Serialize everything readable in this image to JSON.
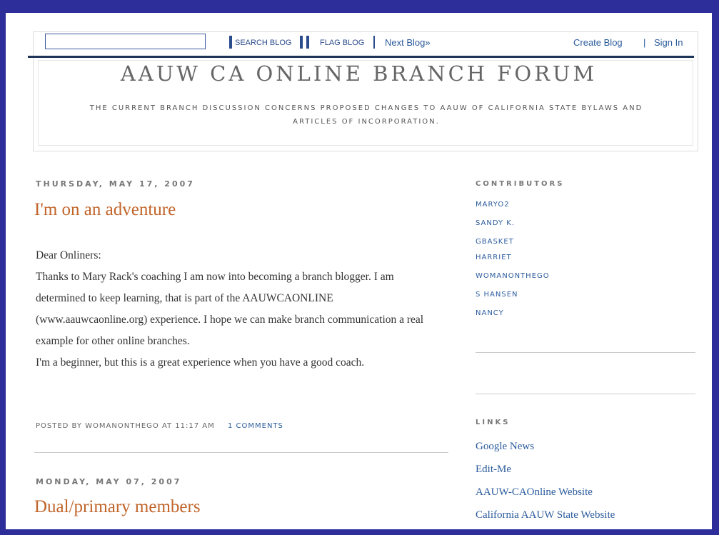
{
  "navbar": {
    "search_value": "",
    "search_button": "SEARCH BLOG",
    "flag_button": "FLAG BLOG",
    "next_blog": "Next Blog»",
    "create_blog": "Create Blog",
    "divider": "|",
    "sign_in": "Sign In"
  },
  "header": {
    "title": "AAUW CA ONLINE BRANCH FORUM",
    "description": "THE CURRENT BRANCH DISCUSSION CONCERNS PROPOSED CHANGES TO AAUW OF CALIFORNIA STATE BYLAWS AND ARTICLES OF INCORPORATION."
  },
  "posts": [
    {
      "date": "THURSDAY, MAY 17, 2007",
      "title": "I'm on an adventure",
      "body": [
        "Dear Onliners:",
        "Thanks to Mary Rack's coaching I am now into becoming a branch blogger. I am determined to keep learning, that is part of the AAUWCAONLINE (www.aauwcaonline.org) experience. I hope we can make branch communication a real example for other online branches.",
        "I'm a beginner, but this is a great experience when you have a good coach."
      ],
      "footer": "POSTED BY WOMANONTHEGO AT 11:17 AM",
      "comments": "1 COMMENTS"
    },
    {
      "date": "MONDAY, MAY 07, 2007",
      "title": "Dual/primary members"
    }
  ],
  "sidebar": {
    "contributors_heading": "CONTRIBUTORS",
    "contributors": [
      "MARYO2",
      "SANDY K.",
      "GBASKET",
      "HARRIET",
      "WOMANONTHEGO",
      "S HANSEN",
      "NANCY"
    ],
    "links_heading": "LINKS",
    "links": [
      "Google News",
      "Edit-Me",
      "AAUW-CAOnline Website",
      "California AAUW State Website"
    ]
  },
  "colors": {
    "outer_background": "#2e2e9a",
    "link": "#2b5b9c",
    "post_title": "#c1642a"
  }
}
